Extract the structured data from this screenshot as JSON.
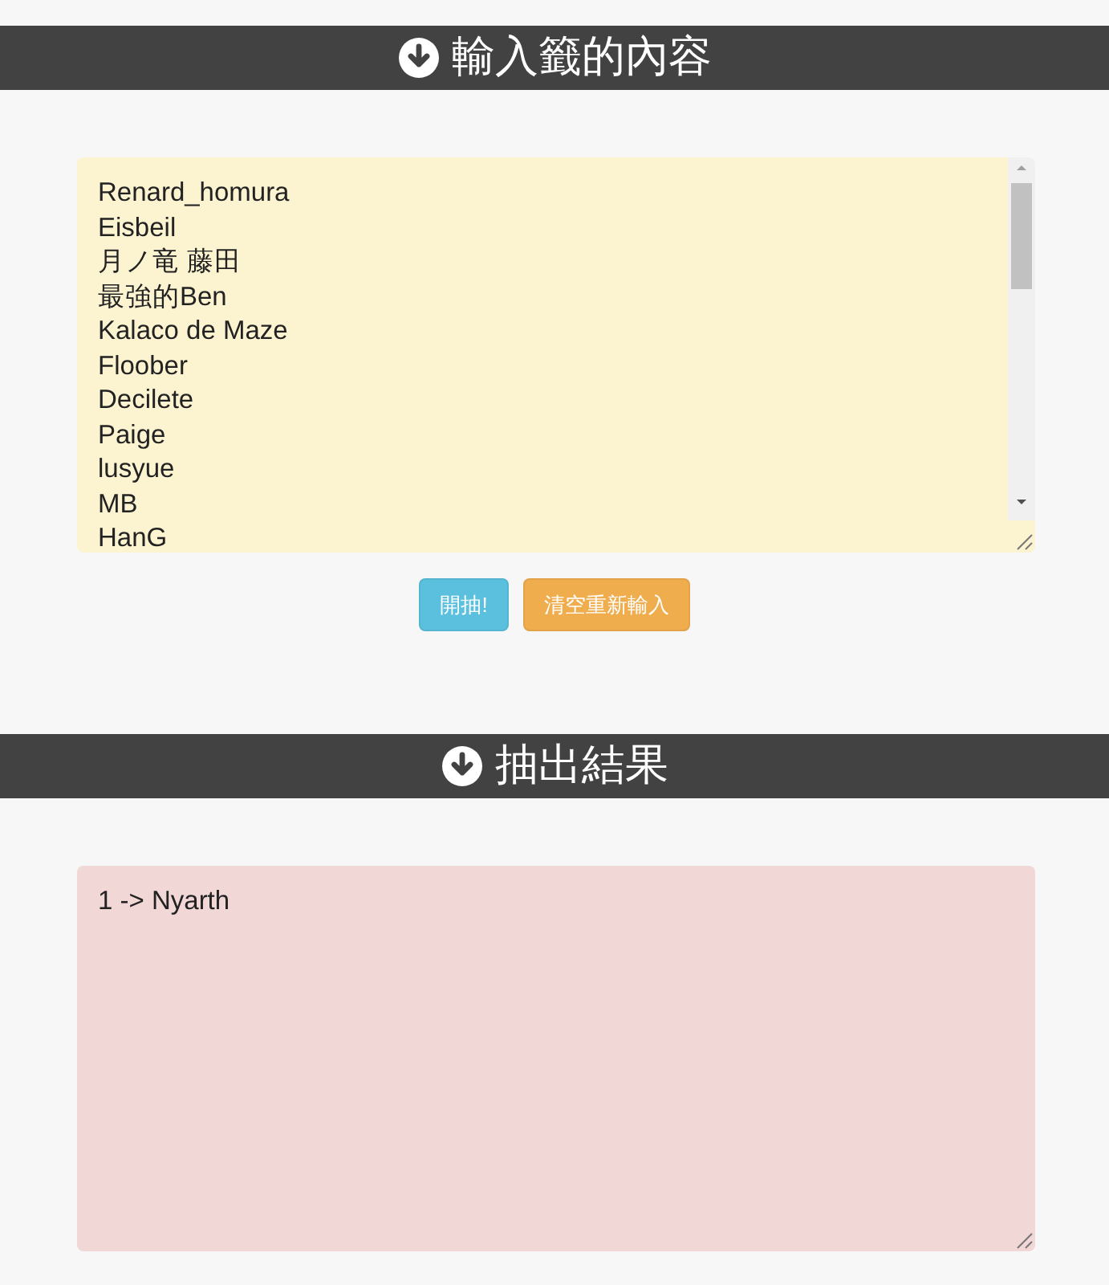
{
  "input_section": {
    "title": "輸入籤的內容",
    "entries": [
      "Renard_homura",
      "Eisbeil",
      "月ノ竜 藤田",
      "最強的Ben",
      "Kalaco de Maze",
      "Floober",
      "Decilete",
      "Paige",
      "lusyue",
      "MB",
      "HanG"
    ]
  },
  "buttons": [
    {
      "label": "開抽!",
      "kind": "info"
    },
    {
      "label": "清空重新輸入",
      "kind": "warning"
    }
  ],
  "result_section": {
    "title": "抽出結果",
    "lines": [
      "1 -> Nyarth"
    ]
  }
}
